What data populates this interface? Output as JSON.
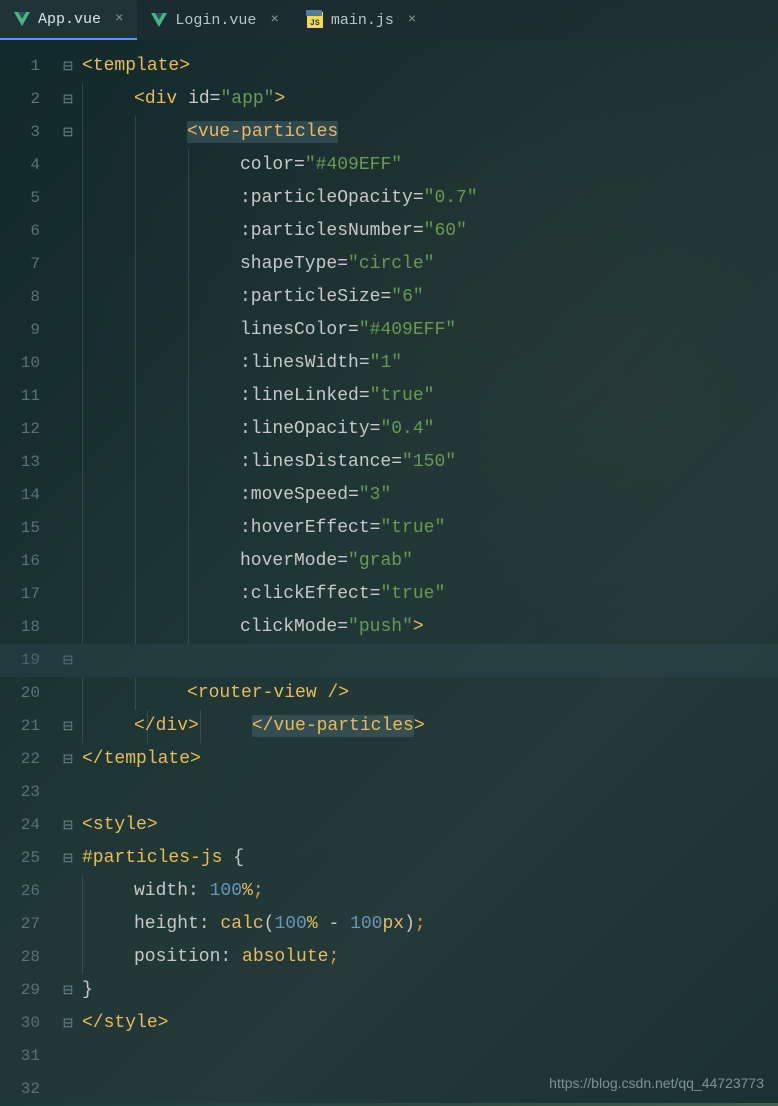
{
  "tabs": [
    {
      "label": "App.vue",
      "active": true,
      "icon": "vue"
    },
    {
      "label": "Login.vue",
      "active": false,
      "icon": "vue"
    },
    {
      "label": "main.js",
      "active": false,
      "icon": "js"
    }
  ],
  "watermark": "https://blog.csdn.net/qq_44723773",
  "code": {
    "l1": {
      "open": "<",
      "tag": "template",
      "close": ">"
    },
    "l2": {
      "open": "<",
      "tag": "div",
      "attr": "id",
      "eq": "=",
      "q1": "\"",
      "val": "app",
      "q2": "\"",
      "close": ">"
    },
    "l3": {
      "open": "<",
      "tag": "vue-particles"
    },
    "l4": {
      "attr": "color",
      "eq": "=",
      "q1": "\"",
      "val": "#409EFF",
      "q2": "\""
    },
    "l5": {
      "attr": ":particleOpacity",
      "eq": "=",
      "q1": "\"",
      "val": "0.7",
      "q2": "\""
    },
    "l6": {
      "attr": ":particlesNumber",
      "eq": "=",
      "q1": "\"",
      "val": "60",
      "q2": "\""
    },
    "l7": {
      "attr": "shapeType",
      "eq": "=",
      "q1": "\"",
      "val": "circle",
      "q2": "\""
    },
    "l8": {
      "attr": ":particleSize",
      "eq": "=",
      "q1": "\"",
      "val": "6",
      "q2": "\""
    },
    "l9": {
      "attr": "linesColor",
      "eq": "=",
      "q1": "\"",
      "val": "#409EFF",
      "q2": "\""
    },
    "l10": {
      "attr": ":linesWidth",
      "eq": "=",
      "q1": "\"",
      "val": "1",
      "q2": "\""
    },
    "l11": {
      "attr": ":lineLinked",
      "eq": "=",
      "q1": "\"",
      "val": "true",
      "q2": "\""
    },
    "l12": {
      "attr": ":lineOpacity",
      "eq": "=",
      "q1": "\"",
      "val": "0.4",
      "q2": "\""
    },
    "l13": {
      "attr": ":linesDistance",
      "eq": "=",
      "q1": "\"",
      "val": "150",
      "q2": "\""
    },
    "l14": {
      "attr": ":moveSpeed",
      "eq": "=",
      "q1": "\"",
      "val": "3",
      "q2": "\""
    },
    "l15": {
      "attr": ":hoverEffect",
      "eq": "=",
      "q1": "\"",
      "val": "true",
      "q2": "\""
    },
    "l16": {
      "attr": "hoverMode",
      "eq": "=",
      "q1": "\"",
      "val": "grab",
      "q2": "\""
    },
    "l17": {
      "attr": ":clickEffect",
      "eq": "=",
      "q1": "\"",
      "val": "true",
      "q2": "\""
    },
    "l18": {
      "attr": "clickMode",
      "eq": "=",
      "q1": "\"",
      "val": "push",
      "q2": "\"",
      "close": ">"
    },
    "l19": {
      "open": "</",
      "tag": "vue-particles",
      "close": ">"
    },
    "l20": {
      "open": "<",
      "tag": "router-view",
      "close": " />"
    },
    "l21": {
      "open": "</",
      "tag": "div",
      "close": ">"
    },
    "l22": {
      "open": "</",
      "tag": "template",
      "close": ">"
    },
    "l24": {
      "open": "<",
      "tag": "style",
      "close": ">"
    },
    "l25": {
      "sel": "#particles-js",
      "brace": " {"
    },
    "l26": {
      "prop": "width",
      "colon": ": ",
      "val": "100",
      "pct": "%",
      "semi": ";"
    },
    "l27": {
      "prop": "height",
      "colon": ": ",
      "fn": "calc",
      "paren1": "(",
      "v1": "100",
      "p1": "%",
      "sp1": " - ",
      "v2": "100",
      "p2": "px",
      "paren2": ")",
      "semi": ";"
    },
    "l28": {
      "prop": "position",
      "colon": ": ",
      "val": "absolute",
      "semi": ";"
    },
    "l29": {
      "brace": "}"
    },
    "l30": {
      "open": "</",
      "tag": "style",
      "close": ">"
    }
  }
}
